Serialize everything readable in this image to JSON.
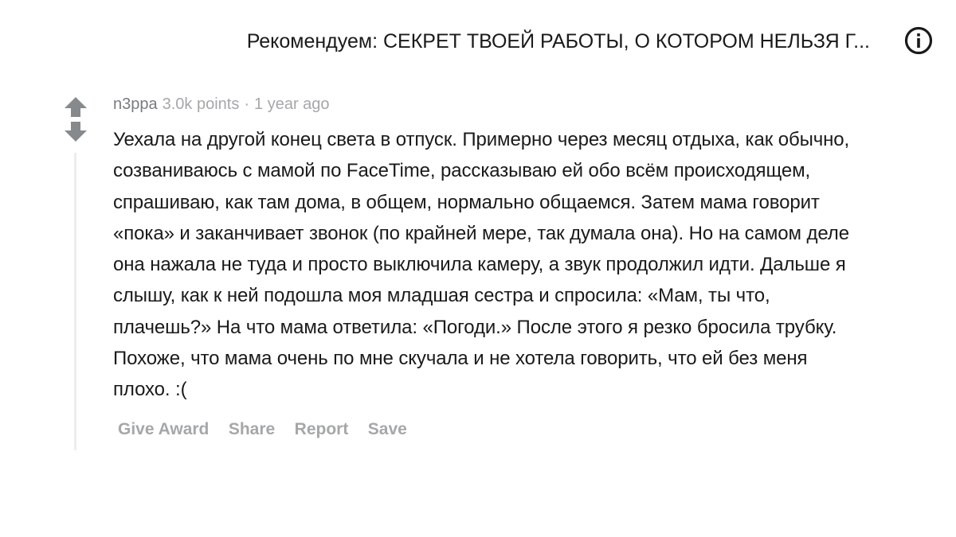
{
  "header": {
    "recommend_text": "Рекомендуем: СЕКРЕТ ТВОЕЙ РАБОТЫ, О КОТОРОМ НЕЛЬЗЯ Г...",
    "info_icon": "info-circle-icon"
  },
  "comment": {
    "author": "n3ppa",
    "points": "3.0k points",
    "separator": "·",
    "age": "1 year ago",
    "body": "Уехала на другой конец света в отпуск. Примерно через месяц отдыха, как обычно, созваниваюсь с мамой по FaceTime, рассказываю ей обо всём происходящем, спрашиваю, как там дома, в общем, нормально общаемся. Затем мама говорит «пока» и заканчивает звонок (по крайней мере, так думала она). Но на самом деле она нажала не туда и просто выключила камеру, а звук продолжил идти. Дальше я слышу, как к ней подошла моя младшая сестра и спросила: «Мам, ты что, плачешь?» На что мама ответила: «Погоди.» После этого я резко бросила трубку. Похоже, что мама очень по мне скучала и не хотела говорить, что ей без меня плохо. :(",
    "upvote_icon": "upvote-arrow-icon",
    "downvote_icon": "downvote-arrow-icon",
    "actions": {
      "give_award": "Give Award",
      "share": "Share",
      "report": "Report",
      "save": "Save"
    }
  },
  "colors": {
    "text": "#1a1a1b",
    "meta": "#a5a7a9",
    "author": "#787c7e",
    "vote_icon": "#878a8c",
    "thread_line": "#ededed"
  }
}
